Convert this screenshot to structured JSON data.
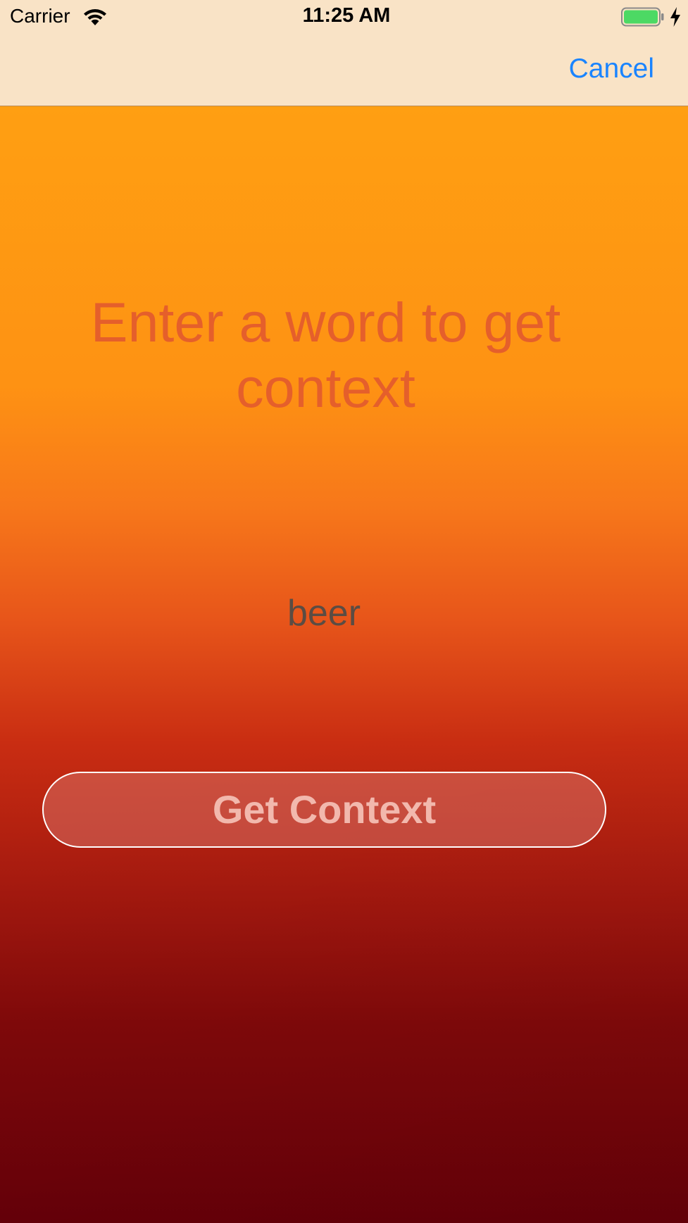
{
  "status_bar": {
    "carrier": "Carrier",
    "time": "11:25 AM",
    "battery_level": 1.0,
    "charging": true
  },
  "nav_bar": {
    "cancel_label": "Cancel"
  },
  "main": {
    "prompt": "Enter a word to get context",
    "word_value": "beer",
    "button_label": "Get Context"
  },
  "colors": {
    "accent": "#1a84ff",
    "nav_background": "#f9e3c6",
    "gradient_top": "#ff9f12",
    "gradient_bottom": "#690009",
    "prompt_text": "#e55f2b",
    "battery_fill": "#4cd964"
  },
  "icons": [
    "wifi-icon",
    "battery-icon",
    "charging-bolt-icon"
  ]
}
